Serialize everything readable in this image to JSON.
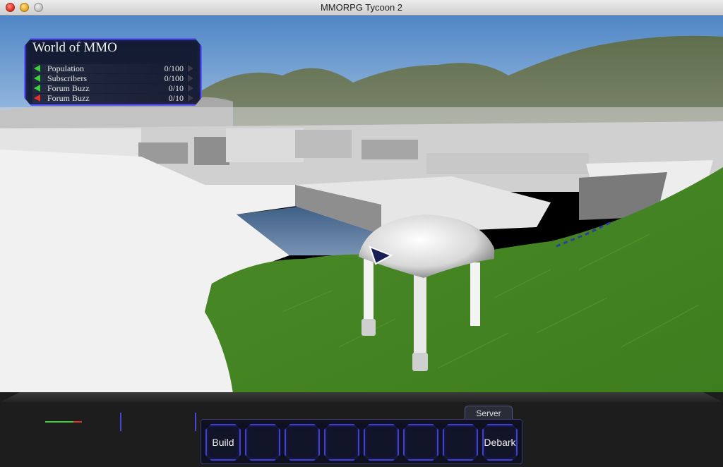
{
  "window": {
    "title": "MMORPG Tycoon 2"
  },
  "hud": {
    "world_name": "World of MMO",
    "stats": [
      {
        "label": "Population",
        "value": "0/100",
        "trend": "up",
        "arrow_color": "#3ad23a"
      },
      {
        "label": "Subscribers",
        "value": "0/100",
        "trend": "up",
        "arrow_color": "#3ad23a"
      },
      {
        "label": "Forum Buzz",
        "value": "0/10",
        "trend": "up",
        "arrow_color": "#3ad23a"
      },
      {
        "label": "Forum Buzz",
        "value": "0/10",
        "trend": "down",
        "arrow_color": "#e2332a"
      }
    ]
  },
  "toolbar": {
    "tab_label": "Server",
    "slots": [
      {
        "label": "Build"
      },
      {
        "label": ""
      },
      {
        "label": ""
      },
      {
        "label": ""
      },
      {
        "label": ""
      },
      {
        "label": ""
      },
      {
        "label": ""
      },
      {
        "label": "Debark"
      }
    ]
  },
  "colors": {
    "accent": "#4040d8",
    "hud_border": "#5a5cff",
    "status_good": "#3ad23a",
    "status_bad": "#e2332a"
  }
}
